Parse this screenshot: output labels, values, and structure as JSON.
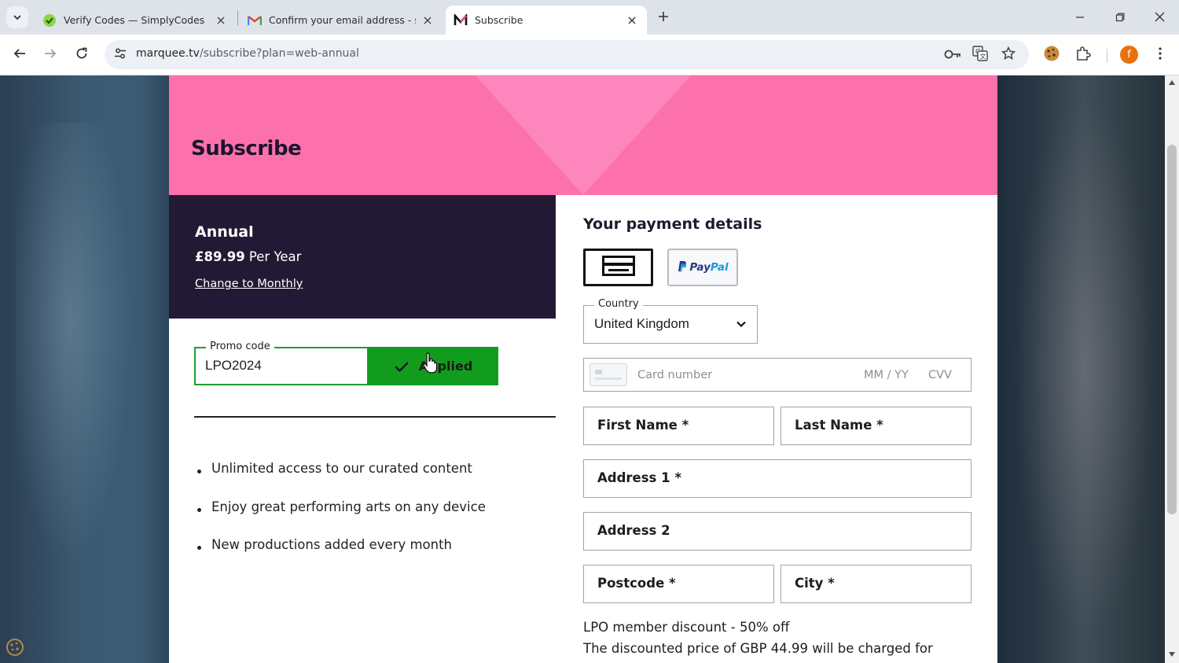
{
  "browser": {
    "tabs": [
      {
        "title": "Verify Codes — SimplyCodes",
        "favicon": "simplycodes-icon",
        "active": false
      },
      {
        "title": "Confirm your email address - sir",
        "favicon": "gmail-icon",
        "active": false
      },
      {
        "title": "Subscribe",
        "favicon": "marquee-m-icon",
        "active": true
      }
    ],
    "url": {
      "host": "marquee.tv",
      "path": "/subscribe?plan=web-annual"
    },
    "profile_initial": "f",
    "profile_color": "#e8710a"
  },
  "page": {
    "hero_title": "Subscribe",
    "hero_color": "#fc71ab",
    "plan": {
      "name": "Annual",
      "price": "£89.99",
      "period": "Per Year",
      "change_link": "Change to Monthly"
    },
    "promo": {
      "legend": "Promo code",
      "value": "LPO2024",
      "button": "Applied",
      "accent": "#129c1e"
    },
    "benefits": [
      "Unlimited access to our curated content",
      "Enjoy great performing arts on any device",
      "New productions added every month"
    ],
    "payment": {
      "title": "Your payment details",
      "paypal_part1": "Pay",
      "paypal_part2": "Pal",
      "country_legend": "Country",
      "country_value": "United Kingdom",
      "card_number_placeholder": "Card number",
      "expiry_placeholder": "MM / YY",
      "cvv_placeholder": "CVV",
      "fields": {
        "first_name": "First Name *",
        "last_name": "Last Name *",
        "address1": "Address 1 *",
        "address2": "Address 2",
        "postcode": "Postcode *",
        "city": "City *"
      },
      "discount_line1": "LPO member discount - 50% off",
      "discount_line2": "The discounted price of GBP 44.99 will be charged for"
    }
  }
}
